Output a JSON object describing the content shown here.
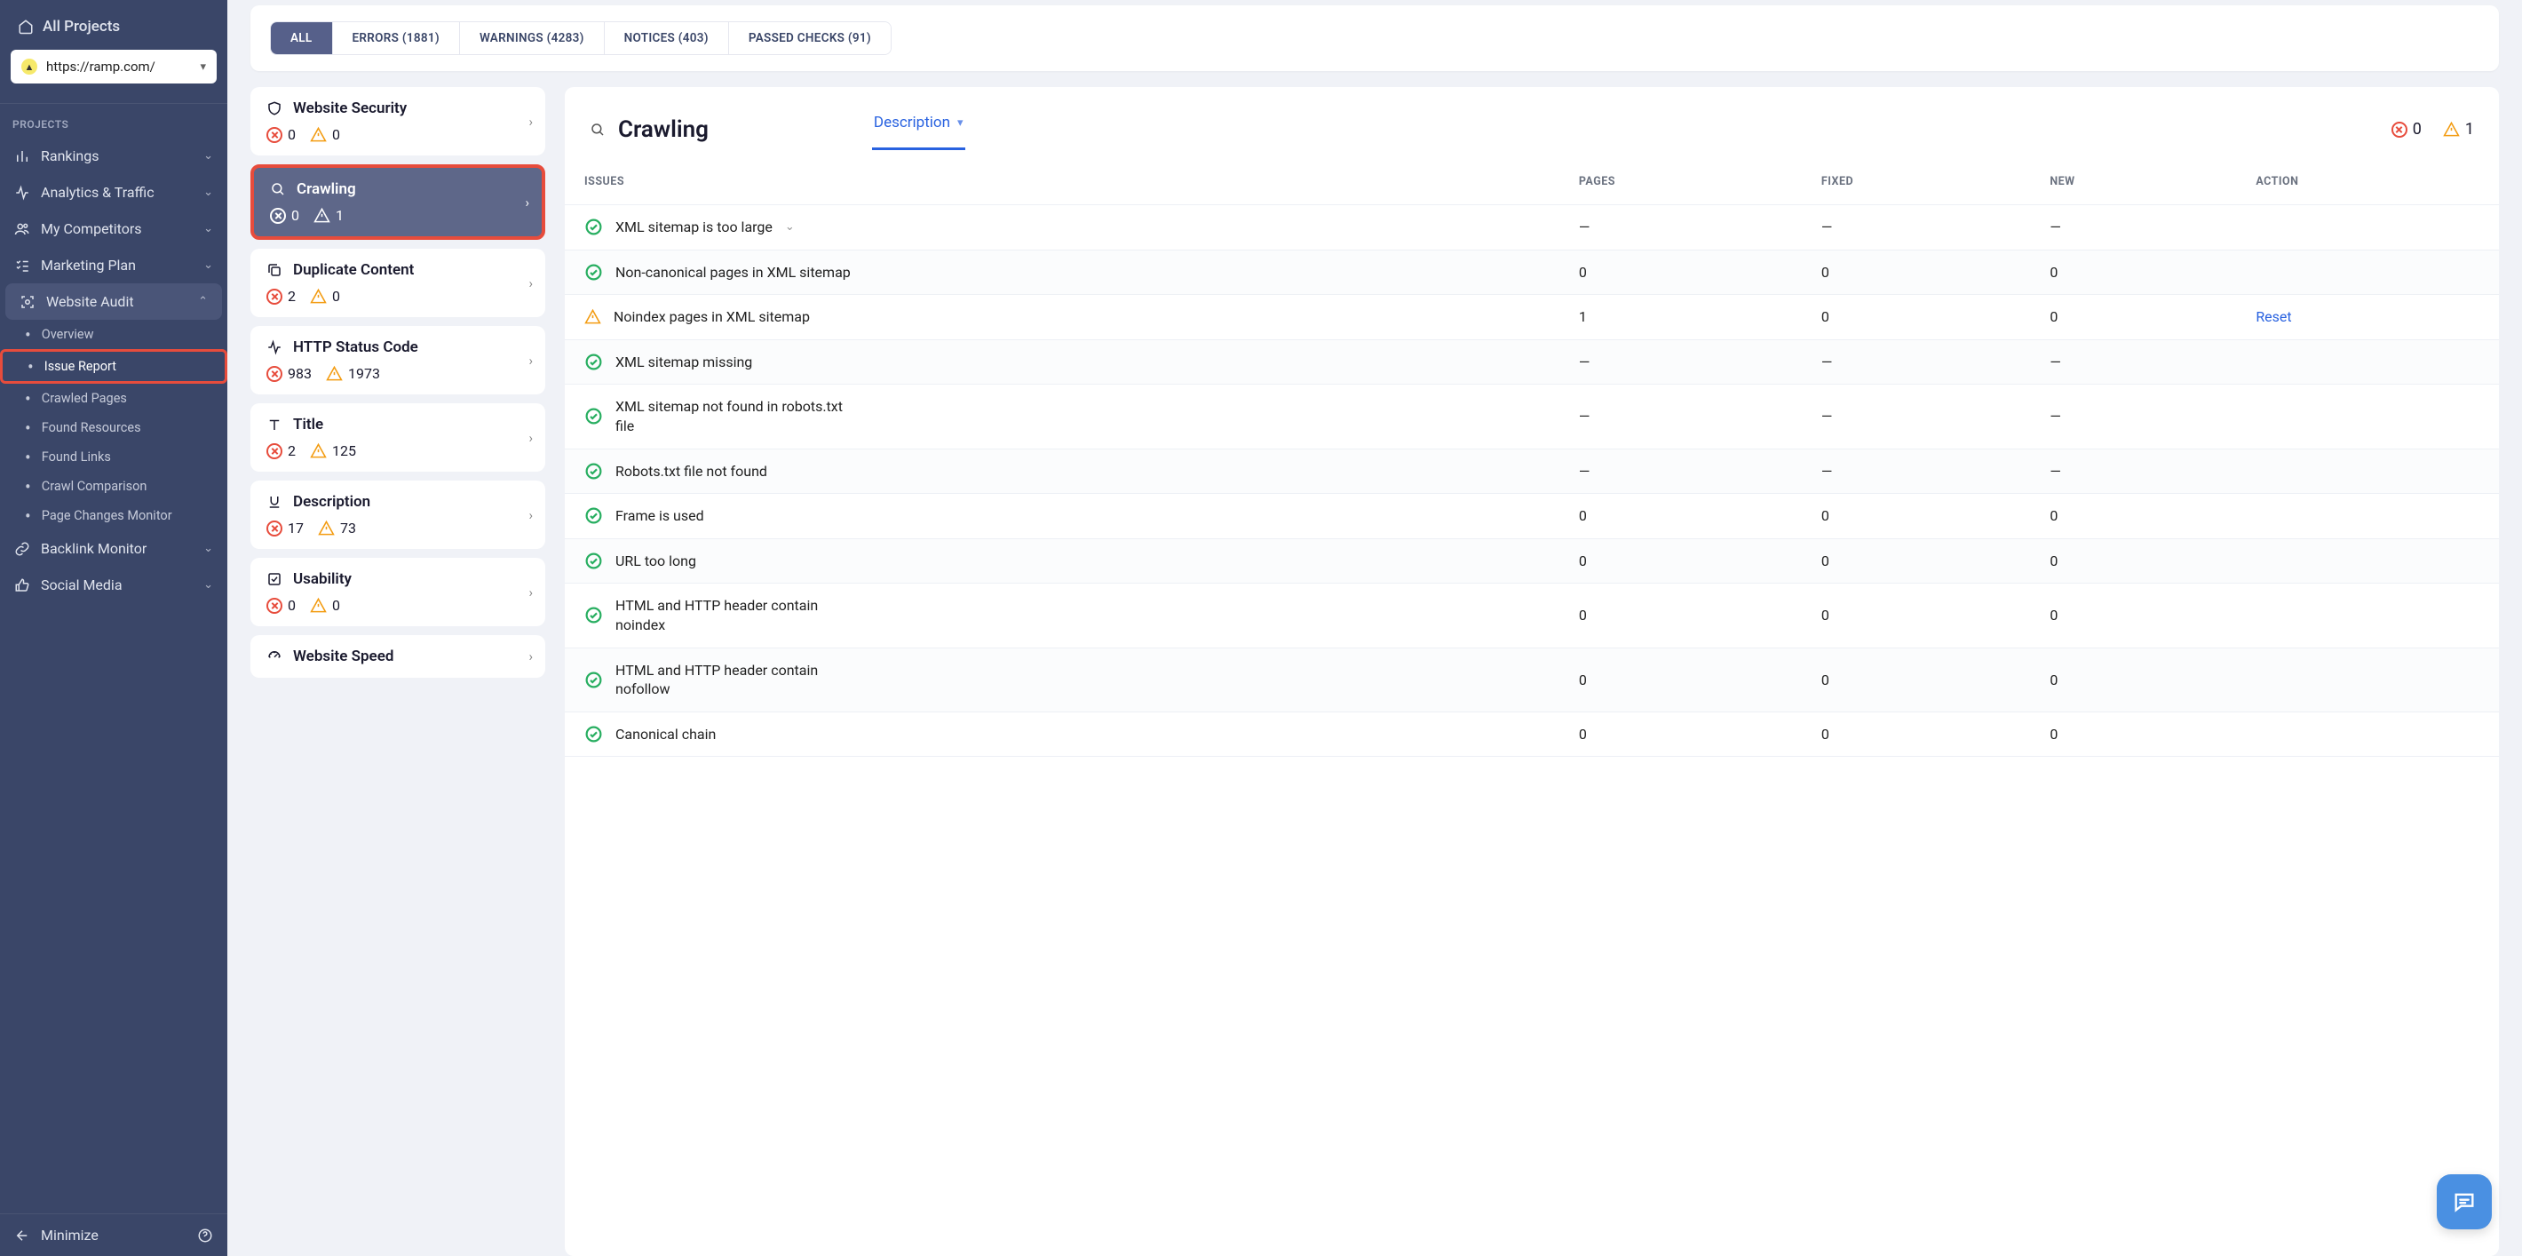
{
  "sidebar": {
    "all_projects": "All Projects",
    "project_url": "https://ramp.com/",
    "projects_label": "PROJECTS",
    "items": [
      {
        "label": "Rankings",
        "icon": "bar-chart-icon"
      },
      {
        "label": "Analytics & Traffic",
        "icon": "activity-icon"
      },
      {
        "label": "My Competitors",
        "icon": "users-icon"
      },
      {
        "label": "Marketing Plan",
        "icon": "check-list-icon"
      },
      {
        "label": "Website Audit",
        "icon": "scan-icon",
        "expanded": true
      },
      {
        "label": "Backlink Monitor",
        "icon": "link-icon"
      },
      {
        "label": "Social Media",
        "icon": "thumbs-up-icon"
      }
    ],
    "audit_subitems": [
      {
        "label": "Overview"
      },
      {
        "label": "Issue Report",
        "active": true
      },
      {
        "label": "Crawled Pages"
      },
      {
        "label": "Found Resources"
      },
      {
        "label": "Found Links"
      },
      {
        "label": "Crawl Comparison"
      },
      {
        "label": "Page Changes Monitor"
      }
    ],
    "minimize": "Minimize"
  },
  "filter_tabs": [
    {
      "label": "ALL",
      "active": true
    },
    {
      "label": "ERRORS (1881)"
    },
    {
      "label": "WARNINGS (4283)"
    },
    {
      "label": "NOTICES (403)"
    },
    {
      "label": "PASSED CHECKS (91)"
    }
  ],
  "issue_categories": [
    {
      "name": "Website Security",
      "icon": "shield-icon",
      "errors": "0",
      "warnings": "0"
    },
    {
      "name": "Crawling",
      "icon": "search-icon",
      "errors": "0",
      "warnings": "1",
      "selected": true
    },
    {
      "name": "Duplicate Content",
      "icon": "copy-icon",
      "errors": "2",
      "warnings": "0"
    },
    {
      "name": "HTTP Status Code",
      "icon": "pulse-icon",
      "errors": "983",
      "warnings": "1973"
    },
    {
      "name": "Title",
      "icon": "text-icon",
      "errors": "2",
      "warnings": "125"
    },
    {
      "name": "Description",
      "icon": "underline-icon",
      "errors": "17",
      "warnings": "73"
    },
    {
      "name": "Usability",
      "icon": "checkbox-icon",
      "errors": "0",
      "warnings": "0"
    },
    {
      "name": "Website Speed",
      "icon": "speed-icon"
    }
  ],
  "panel": {
    "title": "Crawling",
    "tab": "Description",
    "summary": {
      "errors": "0",
      "warnings": "1"
    },
    "columns": [
      "ISSUES",
      "PAGES",
      "FIXED",
      "NEW",
      "ACTION"
    ],
    "rows": [
      {
        "status": "pass",
        "name": "XML sitemap is too large",
        "expandable": true,
        "pages": "—",
        "fixed": "—",
        "new": "—",
        "action": ""
      },
      {
        "status": "pass",
        "name": "Non-canonical pages in XML sitemap",
        "pages": "0",
        "fixed": "0",
        "new": "0",
        "action": ""
      },
      {
        "status": "warn",
        "name": "Noindex pages in XML sitemap",
        "pages": "1",
        "fixed": "0",
        "new": "0",
        "action": "Reset"
      },
      {
        "status": "pass",
        "name": "XML sitemap missing",
        "pages": "—",
        "fixed": "—",
        "new": "—",
        "action": ""
      },
      {
        "status": "pass",
        "name": "XML sitemap not found in robots.txt file",
        "pages": "—",
        "fixed": "—",
        "new": "—",
        "action": ""
      },
      {
        "status": "pass",
        "name": "Robots.txt file not found",
        "pages": "—",
        "fixed": "—",
        "new": "—",
        "action": ""
      },
      {
        "status": "pass",
        "name": "Frame is used",
        "pages": "0",
        "fixed": "0",
        "new": "0",
        "action": ""
      },
      {
        "status": "pass",
        "name": "URL too long",
        "pages": "0",
        "fixed": "0",
        "new": "0",
        "action": ""
      },
      {
        "status": "pass",
        "name": "HTML and HTTP header contain noindex",
        "pages": "0",
        "fixed": "0",
        "new": "0",
        "action": ""
      },
      {
        "status": "pass",
        "name": "HTML and HTTP header contain nofollow",
        "pages": "0",
        "fixed": "0",
        "new": "0",
        "action": ""
      },
      {
        "status": "pass",
        "name": "Canonical chain",
        "pages": "0",
        "fixed": "0",
        "new": "0",
        "action": ""
      }
    ]
  }
}
